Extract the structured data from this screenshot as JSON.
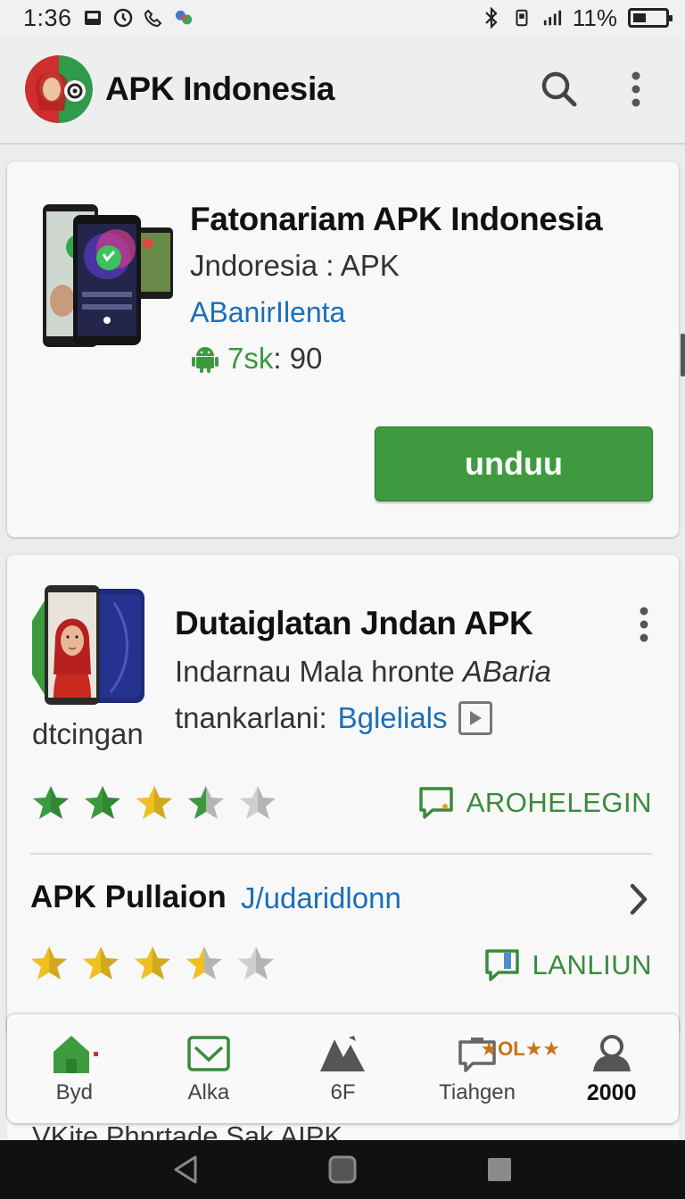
{
  "status_bar": {
    "time": "1:36",
    "battery_text": "11%"
  },
  "app_bar": {
    "title": "APK Indonesia",
    "search_icon": "search-icon",
    "menu_icon": "more-vert-icon"
  },
  "featured": {
    "title": "Fatonariam APK Indonesia",
    "subtitle": "Jndoresia : APK",
    "link": "ABanirIlenta",
    "version_prefix": "7sk",
    "version_rest": ": 90",
    "download_label": "unduu"
  },
  "listing": {
    "title": "Dutaiglatan Jndan APK",
    "caption": "dtcingan",
    "desc_plain": "Indarnau Mala hronte ",
    "desc_italic": "ABaria",
    "line2_label": "tnankarlani:",
    "line2_link": "Bglelials",
    "rating1": 3.5,
    "comment1_label": "AROHELEGIN",
    "row2_title": "APK Pullaion",
    "row2_link": "J/udaridlonn",
    "rating2": 3.5,
    "comment2_label": "LANLIUN"
  },
  "peek": {
    "text": "VKite Phnrtade Sak AIPK"
  },
  "bottom_nav": {
    "items": [
      {
        "label": "Byd",
        "icon": "home-icon"
      },
      {
        "label": "Alka",
        "icon": "inbox-icon"
      },
      {
        "label": "6F",
        "icon": "apps-icon"
      },
      {
        "label": "Tiahgen",
        "icon": "message-icon"
      },
      {
        "label": "2000",
        "icon": "profile-icon"
      }
    ],
    "badge": "★OL★★"
  },
  "colors": {
    "accent_green": "#3f9a3f",
    "link_blue": "#1a6fb8",
    "star_gold": "#f0c020",
    "star_green": "#3a9a3c"
  }
}
